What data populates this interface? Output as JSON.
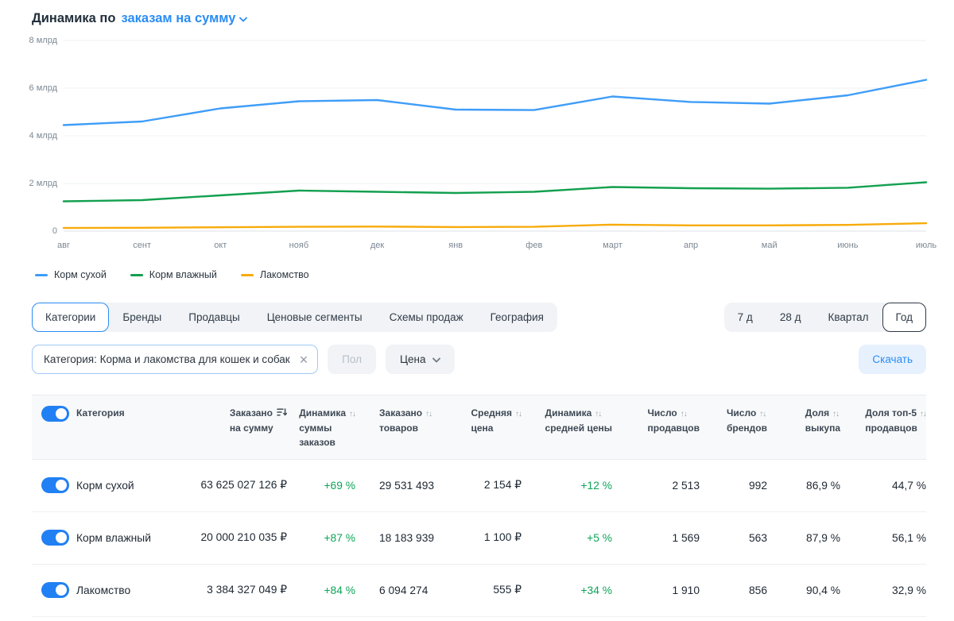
{
  "colors": {
    "accent_blue": "#2a8cf4",
    "positive_green": "#0da457"
  },
  "header": {
    "title_prefix": "Динамика по",
    "metric_selector": "заказам на сумму"
  },
  "chart_data": {
    "type": "line",
    "title": "Динамика по заказам на сумму",
    "x": [
      "авг",
      "сент",
      "окт",
      "нояб",
      "дек",
      "янв",
      "фев",
      "март",
      "апр",
      "май",
      "июнь",
      "июль"
    ],
    "series": [
      {
        "name": "Корм сухой",
        "color": "#3f9df8",
        "values": [
          4.45,
          4.6,
          5.15,
          5.45,
          5.5,
          5.1,
          5.08,
          5.65,
          5.42,
          5.35,
          5.7,
          6.35
        ]
      },
      {
        "name": "Корм влажный",
        "color": "#13a04f",
        "values": [
          1.25,
          1.3,
          1.5,
          1.7,
          1.65,
          1.6,
          1.65,
          1.85,
          1.8,
          1.78,
          1.82,
          2.05
        ]
      },
      {
        "name": "Лакомство",
        "color": "#f7ab0b",
        "values": [
          0.13,
          0.14,
          0.16,
          0.18,
          0.19,
          0.17,
          0.18,
          0.27,
          0.24,
          0.24,
          0.26,
          0.33
        ]
      }
    ],
    "y_ticks": [
      {
        "value": 0,
        "label": "0"
      },
      {
        "value": 2,
        "label": "2 млрд"
      },
      {
        "value": 4,
        "label": "4 млрд"
      },
      {
        "value": 6,
        "label": "6 млрд"
      },
      {
        "value": 8,
        "label": "8 млрд"
      }
    ],
    "ylim": [
      0,
      8
    ],
    "unit": "млрд",
    "grid": "horizontal",
    "legend_position": "bottom"
  },
  "tabs": {
    "left": [
      {
        "id": "categories",
        "label": "Категории",
        "active": true
      },
      {
        "id": "brands",
        "label": "Бренды"
      },
      {
        "id": "sellers",
        "label": "Продавцы"
      },
      {
        "id": "price-segments",
        "label": "Ценовые сегменты"
      },
      {
        "id": "sales-schemes",
        "label": "Схемы продаж"
      },
      {
        "id": "geography",
        "label": "География"
      }
    ],
    "right": [
      {
        "id": "7d",
        "label": "7 д"
      },
      {
        "id": "28d",
        "label": "28 д"
      },
      {
        "id": "quarter",
        "label": "Квартал"
      },
      {
        "id": "year",
        "label": "Год",
        "active": true
      }
    ]
  },
  "filters": {
    "category_chip": "Категория: Корма и лакомства для кошек и собак",
    "gender_label": "Пол",
    "price_label": "Цена",
    "download_label": "Скачать"
  },
  "table": {
    "columns": [
      {
        "id": "category",
        "lines": [
          "Категория"
        ],
        "sort": "none",
        "align": "left"
      },
      {
        "id": "ordered_sum",
        "lines": [
          "Заказано",
          "на сумму"
        ],
        "sort": "applied",
        "align": "right"
      },
      {
        "id": "dynamics_sum",
        "lines": [
          "Динамика",
          "суммы",
          "заказов"
        ],
        "sort": "both",
        "align": "right",
        "color": "green"
      },
      {
        "id": "ordered_items",
        "lines": [
          "Заказано",
          "товаров"
        ],
        "sort": "both",
        "align": "left",
        "indent": 30
      },
      {
        "id": "avg_price",
        "lines": [
          "Средняя",
          "цена"
        ],
        "sort": "both",
        "align": "right"
      },
      {
        "id": "dynamics_price",
        "lines": [
          "Динамика",
          "средней цены"
        ],
        "sort": "both",
        "align": "right",
        "color": "green"
      },
      {
        "id": "sellers",
        "lines": [
          "Число",
          "продавцов"
        ],
        "sort": "both",
        "align": "right"
      },
      {
        "id": "brands",
        "lines": [
          "Число",
          "брендов"
        ],
        "sort": "both",
        "align": "right"
      },
      {
        "id": "buyout",
        "lines": [
          "Доля",
          "выкупа"
        ],
        "sort": "both",
        "align": "right"
      },
      {
        "id": "top5",
        "lines": [
          "Доля топ-5",
          "продавцов"
        ],
        "sort": "both",
        "align": "right"
      }
    ],
    "rows": [
      {
        "enabled": true,
        "category": "Корм сухой",
        "ordered_sum": "63 625 027 126 ₽",
        "dynamics_sum": "+69 %",
        "ordered_items": "29 531 493",
        "avg_price": "2 154 ₽",
        "dynamics_price": "+12 %",
        "sellers": "2 513",
        "brands": "992",
        "buyout": "86,9 %",
        "top5": "44,7 %"
      },
      {
        "enabled": true,
        "category": "Корм влажный",
        "ordered_sum": "20 000 210 035 ₽",
        "dynamics_sum": "+87 %",
        "ordered_items": "18 183 939",
        "avg_price": "1 100 ₽",
        "dynamics_price": "+5 %",
        "sellers": "1 569",
        "brands": "563",
        "buyout": "87,9 %",
        "top5": "56,1 %"
      },
      {
        "enabled": true,
        "category": "Лакомство",
        "ordered_sum": "3 384 327 049 ₽",
        "dynamics_sum": "+84 %",
        "ordered_items": "6 094 274",
        "avg_price": "555 ₽",
        "dynamics_price": "+34 %",
        "sellers": "1 910",
        "brands": "856",
        "buyout": "90,4 %",
        "top5": "32,9 %"
      }
    ]
  }
}
